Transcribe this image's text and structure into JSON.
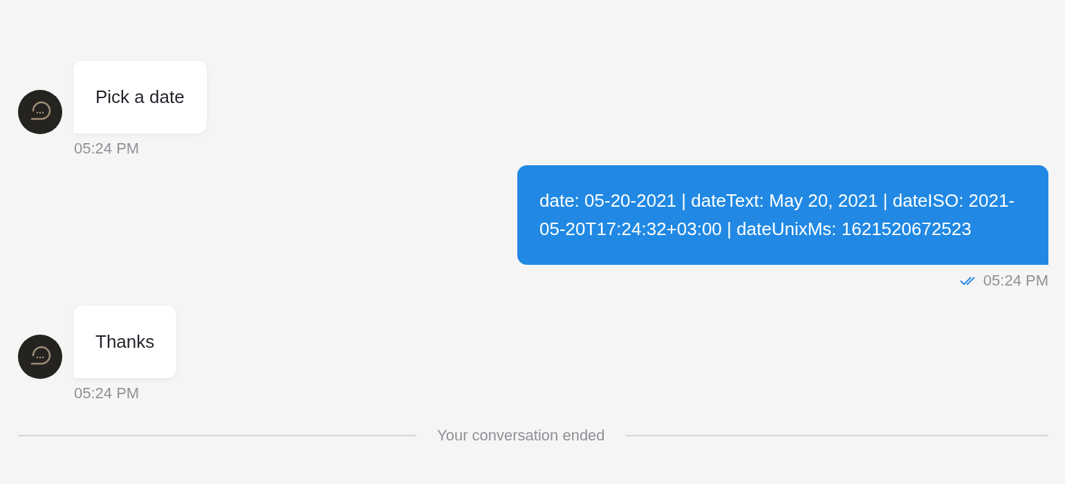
{
  "messages": [
    {
      "kind": "bot",
      "text": "Pick a date",
      "time": "05:24 PM"
    },
    {
      "kind": "user",
      "text": "date: 05-20-2021 | dateText: May 20, 2021 | dateISO: 2021-05-20T17:24:32+03:00 | dateUnixMs: 1621520672523",
      "time": "05:24 PM",
      "read": true
    },
    {
      "kind": "bot",
      "text": "Thanks",
      "time": "05:24 PM"
    }
  ],
  "footer": {
    "text": "Your conversation ended"
  }
}
